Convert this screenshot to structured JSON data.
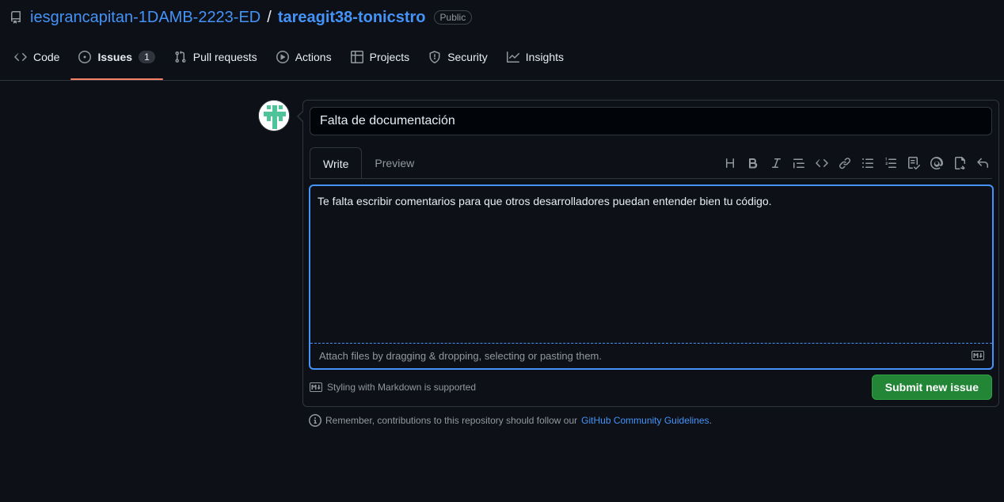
{
  "repo": {
    "owner": "iesgrancapitan-1DAMB-2223-ED",
    "separator": "/",
    "name": "tareagit38-tonicstro",
    "visibility": "Public",
    "icon": "repo-icon"
  },
  "tabs": [
    {
      "label": "Code",
      "icon": "code-icon"
    },
    {
      "label": "Issues",
      "icon": "issue-opened-icon",
      "counter": "1",
      "active": true
    },
    {
      "label": "Pull requests",
      "icon": "git-pull-request-icon"
    },
    {
      "label": "Actions",
      "icon": "play-icon"
    },
    {
      "label": "Projects",
      "icon": "table-icon"
    },
    {
      "label": "Security",
      "icon": "shield-icon"
    },
    {
      "label": "Insights",
      "icon": "graph-icon"
    }
  ],
  "form": {
    "title_value": "Falta de documentación",
    "editor_tabs": {
      "write": "Write",
      "preview": "Preview"
    },
    "toolbar_icons": [
      "heading-icon",
      "bold-icon",
      "italic-icon",
      "quote-icon",
      "code-icon",
      "link-icon",
      "unordered-list-icon",
      "ordered-list-icon",
      "task-list-icon",
      "mention-icon",
      "cross-reference-icon",
      "reply-icon"
    ],
    "body_text": "Te falta escribir comentarios para que otros desarrolladores puedan entender bien tu código.",
    "attach_text": "Attach files by dragging & dropping, selecting or pasting them.",
    "markdown_note": "Styling with Markdown is supported",
    "submit_label": "Submit new issue"
  },
  "footer": {
    "text": "Remember, contributions to this repository should follow our",
    "link": "GitHub Community Guidelines",
    "period": "."
  },
  "colors": {
    "background": "#0d1117",
    "link": "#4493f8",
    "active_tab_underline": "#f78166",
    "submit": "#238636",
    "focus": "#4493f8"
  }
}
